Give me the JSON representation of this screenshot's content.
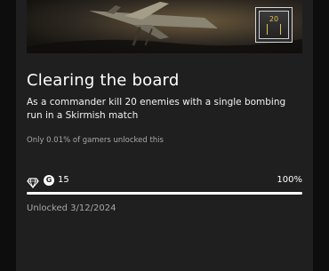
{
  "achievement": {
    "title": "Clearing the board",
    "description": "As a commander kill 20 enemies with a single bombing run in a Skirmish match",
    "rarity_text": "Only 0.01% of gamers unlocked this",
    "gamerscore_badge": "G",
    "gamerscore": "15",
    "progress_label": "100%",
    "progress_fraction": 1.0,
    "unlocked_text": "Unlocked 3/12/2024",
    "badge_number": "20"
  },
  "icons": {
    "rarity": "diamond-icon",
    "gamerscore": "gamerscore-icon"
  },
  "colors": {
    "card": "#1f1f1f",
    "badge_gold": "#e6c14a",
    "progress_fill": "#ffffff",
    "progress_track": "#4a4a4a"
  }
}
